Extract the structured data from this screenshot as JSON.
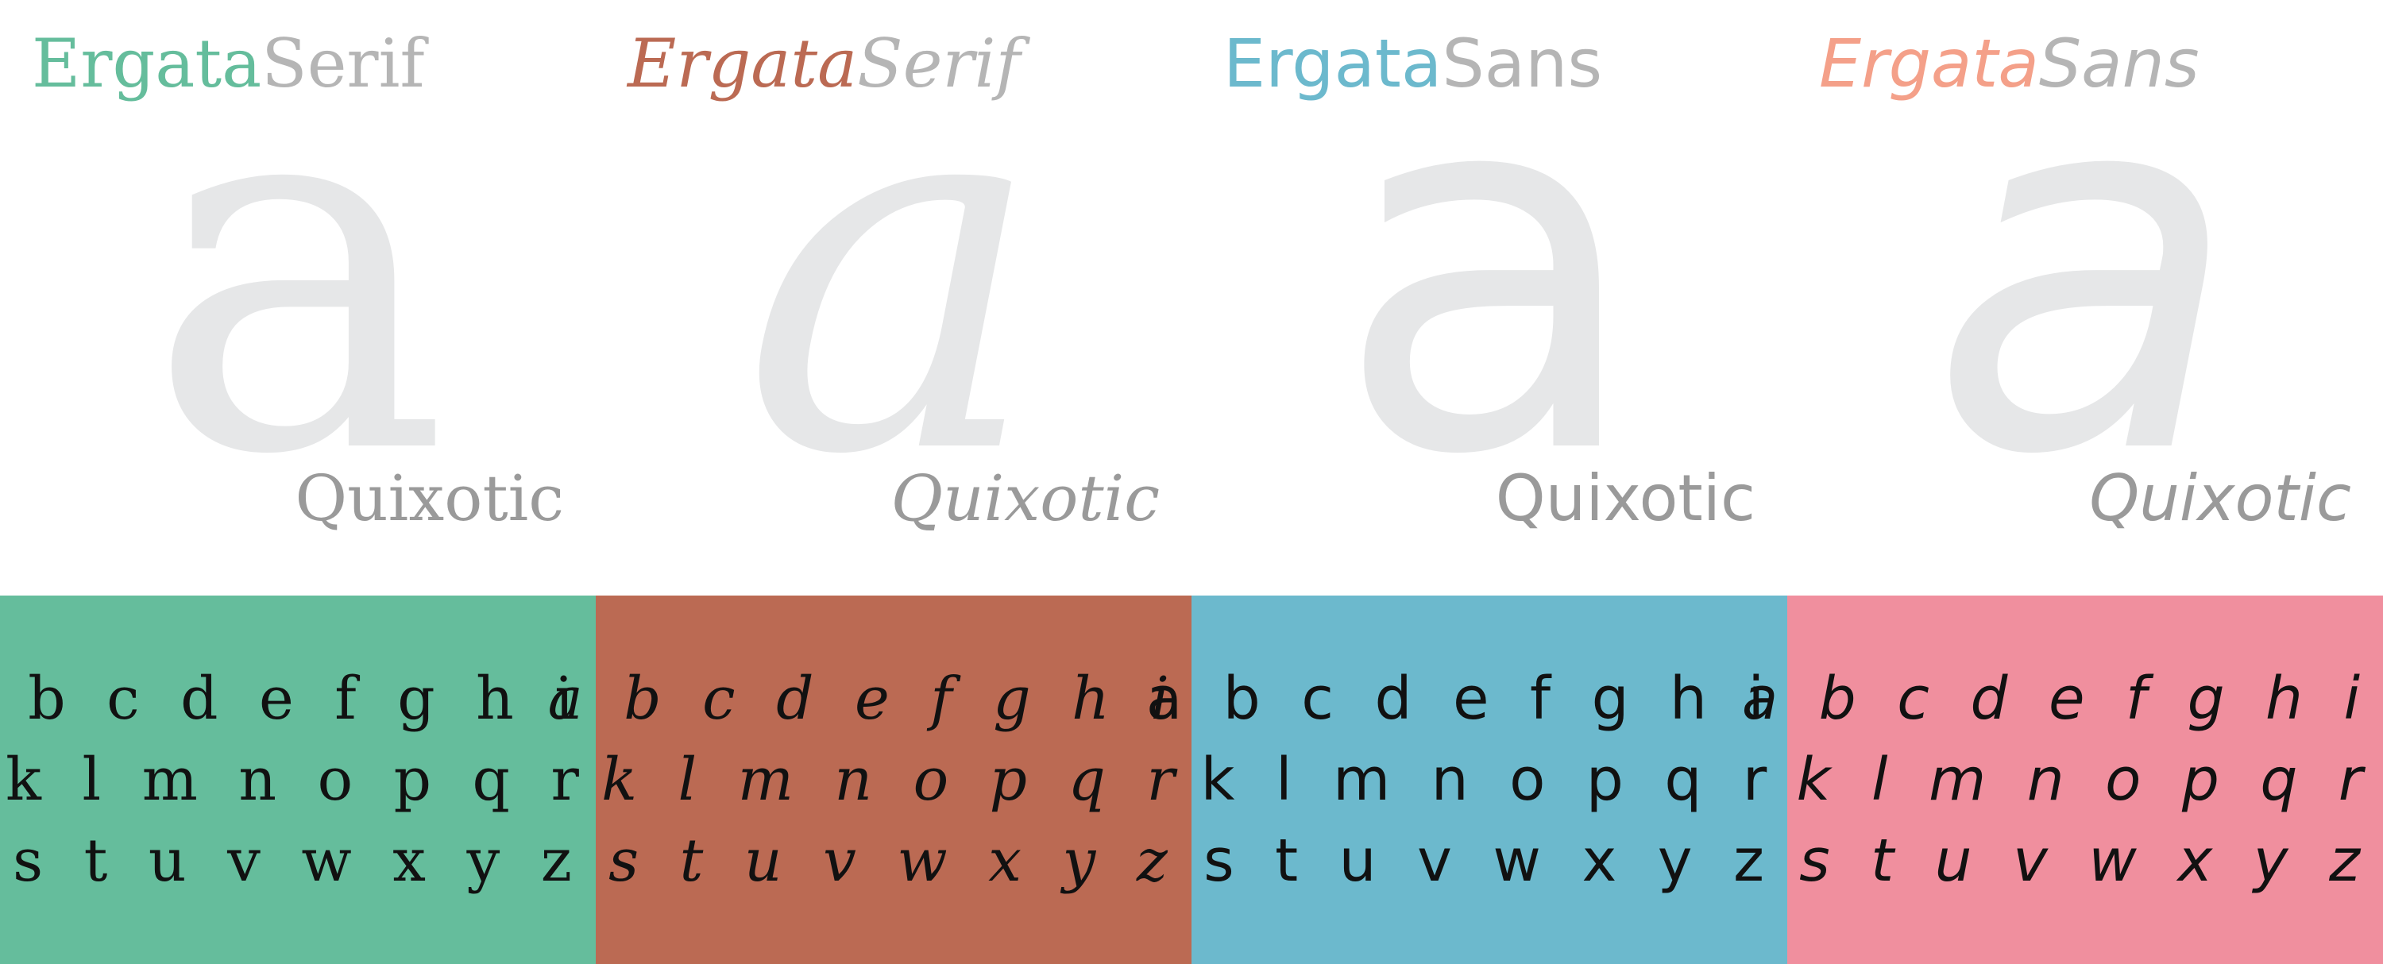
{
  "colors": {
    "serif_green": "#65bd9c",
    "serif_italic_red": "#bb6a53",
    "sans_blue": "#6cb9cd",
    "sans_italic_pink": "#f08f9e",
    "title_gray": "#b5b5b5",
    "glyph_gray": "#e6e7e8",
    "sample_gray": "#9a9a9a"
  },
  "panels": [
    {
      "name_part1": "Ergata",
      "name_part2": "Serif",
      "glyph": "a",
      "sample": "Quixotic",
      "alphabet": [
        "a b c d e f g h i j",
        "k l m n o p q r",
        "s t u v w x y z"
      ]
    },
    {
      "name_part1": "Ergata",
      "name_part2": "Serif",
      "glyph": "a",
      "sample": "Quixotic",
      "alphabet": [
        "a b c d e f g h i j",
        "k l m n o p q r",
        "s t u v w x y z"
      ]
    },
    {
      "name_part1": "Ergata",
      "name_part2": "Sans",
      "glyph": "a",
      "sample": "Quixotic",
      "alphabet": [
        "a b c d e f g h i j",
        "k l m n o p q r",
        "s t u v w x y z"
      ]
    },
    {
      "name_part1": "Ergata",
      "name_part2": "Sans",
      "glyph": "a",
      "sample": "Quixotic",
      "alphabet": [
        "a b c d e f g h i j",
        "k l m n o p q r",
        "s t u v w x y z"
      ]
    }
  ]
}
